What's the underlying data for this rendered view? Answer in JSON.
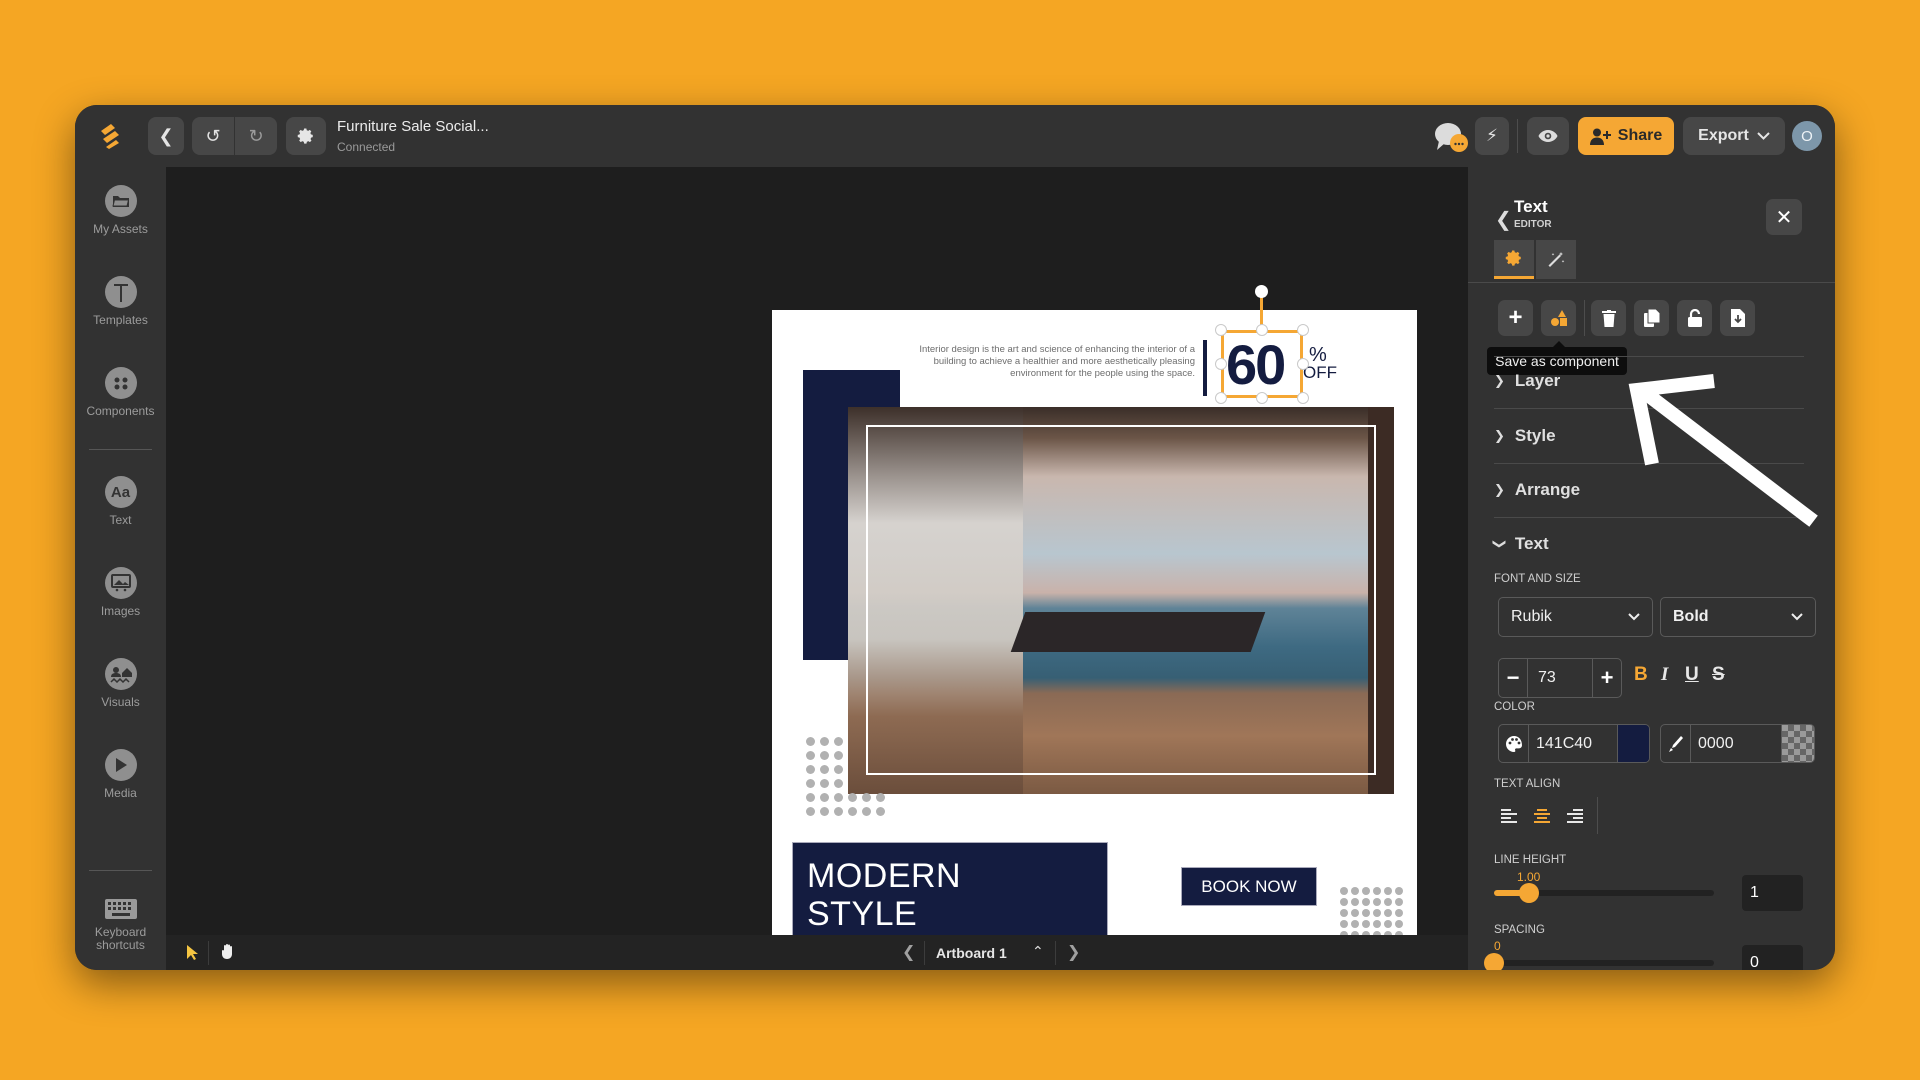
{
  "app": {
    "document_title": "Furniture Sale Social...",
    "connection_status": "Connected",
    "accent_color": "#f5a734",
    "background_color": "#f5a623"
  },
  "toolbar": {
    "share_label": "Share",
    "export_label": "Export",
    "avatar_initial": "O"
  },
  "sidebar": {
    "items": [
      {
        "label": "My Assets",
        "icon": "folder-icon"
      },
      {
        "label": "Templates",
        "icon": "templates-icon"
      },
      {
        "label": "Components",
        "icon": "puzzle-icon"
      },
      {
        "label": "Text",
        "icon": "text-aa-icon"
      },
      {
        "label": "Images",
        "icon": "image-icon"
      },
      {
        "label": "Visuals",
        "icon": "visuals-icon"
      },
      {
        "label": "Media",
        "icon": "play-icon"
      },
      {
        "label": "Keyboard shortcuts",
        "icon": "keyboard-icon"
      }
    ]
  },
  "canvas": {
    "artboard_label": "Artboard 1",
    "design": {
      "description": "Interior design is the art and science of enhancing the interior of a building to achieve a healthier and more aesthetically pleasing environment for the people using the space.",
      "discount_number": "60",
      "discount_percent": "%",
      "discount_off": "OFF",
      "headline_line1": "MODERN",
      "headline_line2": "STYLE",
      "cta_label": "BOOK NOW",
      "brand_navy": "#141c40"
    }
  },
  "panel": {
    "title": "Text",
    "subtitle": "EDITOR",
    "tooltip": "Save as component",
    "sections": {
      "layer": "Layer",
      "style": "Style",
      "arrange": "Arrange",
      "text": "Text"
    },
    "font_and_size_label": "FONT AND SIZE",
    "font_family": "Rubik",
    "font_weight": "Bold",
    "font_size": "73",
    "format": {
      "bold": "B",
      "italic": "I",
      "underline": "U",
      "strike": "S"
    },
    "color_label": "COLOR",
    "fill_color_hex": "141C40",
    "fill_color": "#141c40",
    "stroke_color_value": "0000",
    "text_align_label": "TEXT ALIGN",
    "text_align_selected": "center",
    "line_height_label": "LINE HEIGHT",
    "line_height_display": "1.00",
    "line_height_value": "1",
    "line_height_fraction": 0.16,
    "spacing_label": "SPACING",
    "spacing_display": "0",
    "spacing_value": "0",
    "spacing_fraction": 0
  }
}
